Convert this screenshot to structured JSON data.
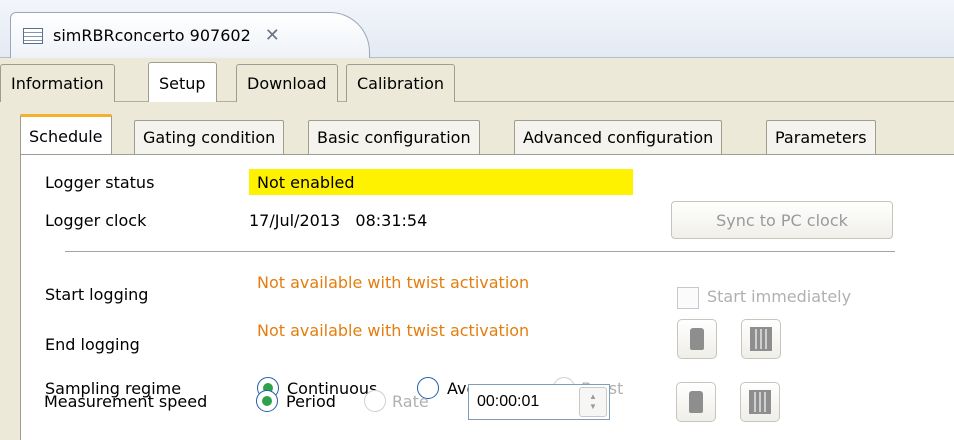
{
  "editor": {
    "title": "simRBRconcerto 907602",
    "icon": "table-icon",
    "close_icon": "close-icon"
  },
  "view_tabs": [
    {
      "label": "Information"
    },
    {
      "label": "Setup",
      "active": true
    },
    {
      "label": "Download"
    },
    {
      "label": "Calibration"
    }
  ],
  "sub_tabs": [
    {
      "label": "Schedule",
      "active": true
    },
    {
      "label": "Gating condition"
    },
    {
      "label": "Basic configuration"
    },
    {
      "label": "Advanced configuration"
    },
    {
      "label": "Parameters"
    }
  ],
  "schedule": {
    "logger_status_label": "Logger status",
    "logger_status_value": "Not enabled",
    "logger_clock_label": "Logger clock",
    "logger_clock_value": "17/Jul/2013   08:31:54",
    "sync_button": "Sync to PC clock",
    "start_logging_label": "Start logging",
    "start_logging_value": "Not available with twist activation",
    "start_immediately_label": "Start immediately",
    "end_logging_label": "End logging",
    "end_logging_value": "Not available with twist activation",
    "sampling_regime_label": "Sampling regime",
    "sampling_options": [
      "Continuous",
      "Average",
      "Burst"
    ],
    "sampling_selected": "Continuous",
    "measurement_speed_label": "Measurement speed",
    "speed_options": [
      "Period",
      "Rate"
    ],
    "speed_selected": "Period",
    "period_value": "00:00:01"
  },
  "colors": {
    "status_highlight": "#fff200",
    "warning_text": "#e37e0e",
    "active_tab_accent": "#f4b12d"
  }
}
